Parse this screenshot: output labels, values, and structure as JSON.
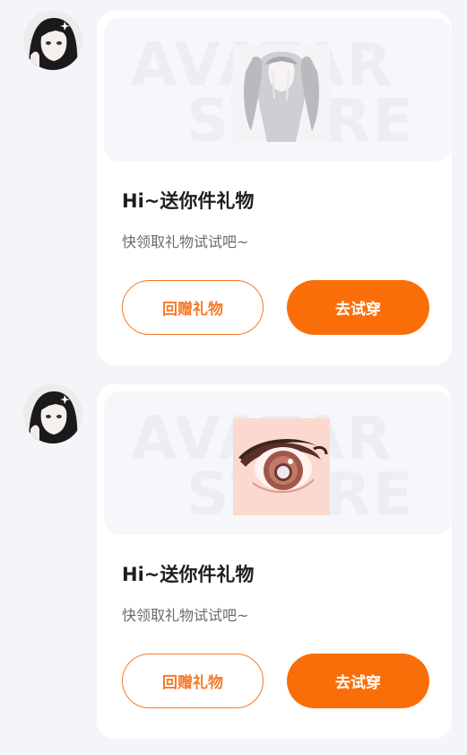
{
  "messages": [
    {
      "avatar_icon": "avatar-girl-icon",
      "watermark_line1": "AVATAR",
      "watermark_line2": "STORE",
      "item_icon": "hair-item-icon",
      "title": "Hi~送你件礼物",
      "subtitle": "快领取礼物试试吧~",
      "return_gift_label": "回赠礼物",
      "try_on_label": "去试穿"
    },
    {
      "avatar_icon": "avatar-girl-icon",
      "watermark_line1": "AVATAR",
      "watermark_line2": "STORE",
      "item_icon": "eye-item-icon",
      "title": "Hi~送你件礼物",
      "subtitle": "快领取礼物试试吧~",
      "return_gift_label": "回赠礼物",
      "try_on_label": "去试穿"
    }
  ],
  "colors": {
    "accent": "#fa6e0a",
    "accent_outline": "#f47b2a",
    "background": "#f3f5f9",
    "card": "#ffffff"
  }
}
